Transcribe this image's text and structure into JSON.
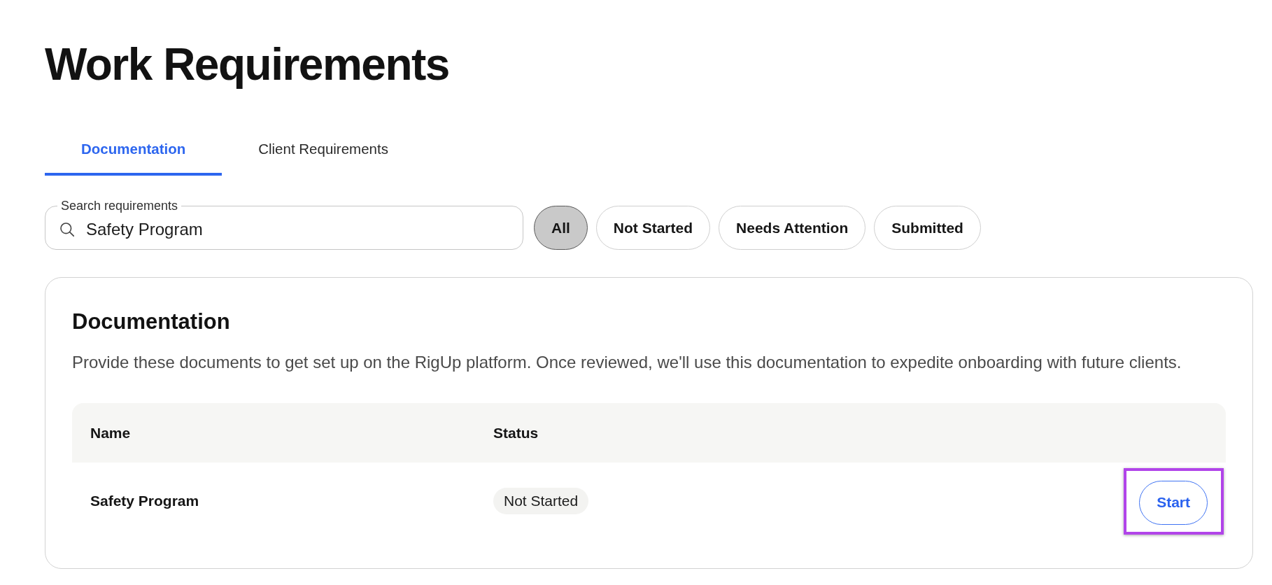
{
  "page": {
    "title": "Work Requirements"
  },
  "tabs": [
    {
      "label": "Documentation",
      "selected": true
    },
    {
      "label": "Client Requirements",
      "selected": false
    }
  ],
  "search": {
    "label": "Search requirements",
    "value": "Safety Program"
  },
  "filters": [
    {
      "label": "All",
      "selected": true
    },
    {
      "label": "Not Started",
      "selected": false
    },
    {
      "label": "Needs Attention",
      "selected": false
    },
    {
      "label": "Submitted",
      "selected": false
    }
  ],
  "section": {
    "title": "Documentation",
    "description": "Provide these documents to get set up on the RigUp platform. Once reviewed, we'll use this documentation to expedite onboarding with future clients.",
    "table": {
      "columns": [
        "Name",
        "Status"
      ],
      "rows": [
        {
          "name": "Safety Program",
          "status": "Not Started",
          "action": {
            "label": "Start",
            "highlighted": true
          }
        }
      ]
    }
  }
}
